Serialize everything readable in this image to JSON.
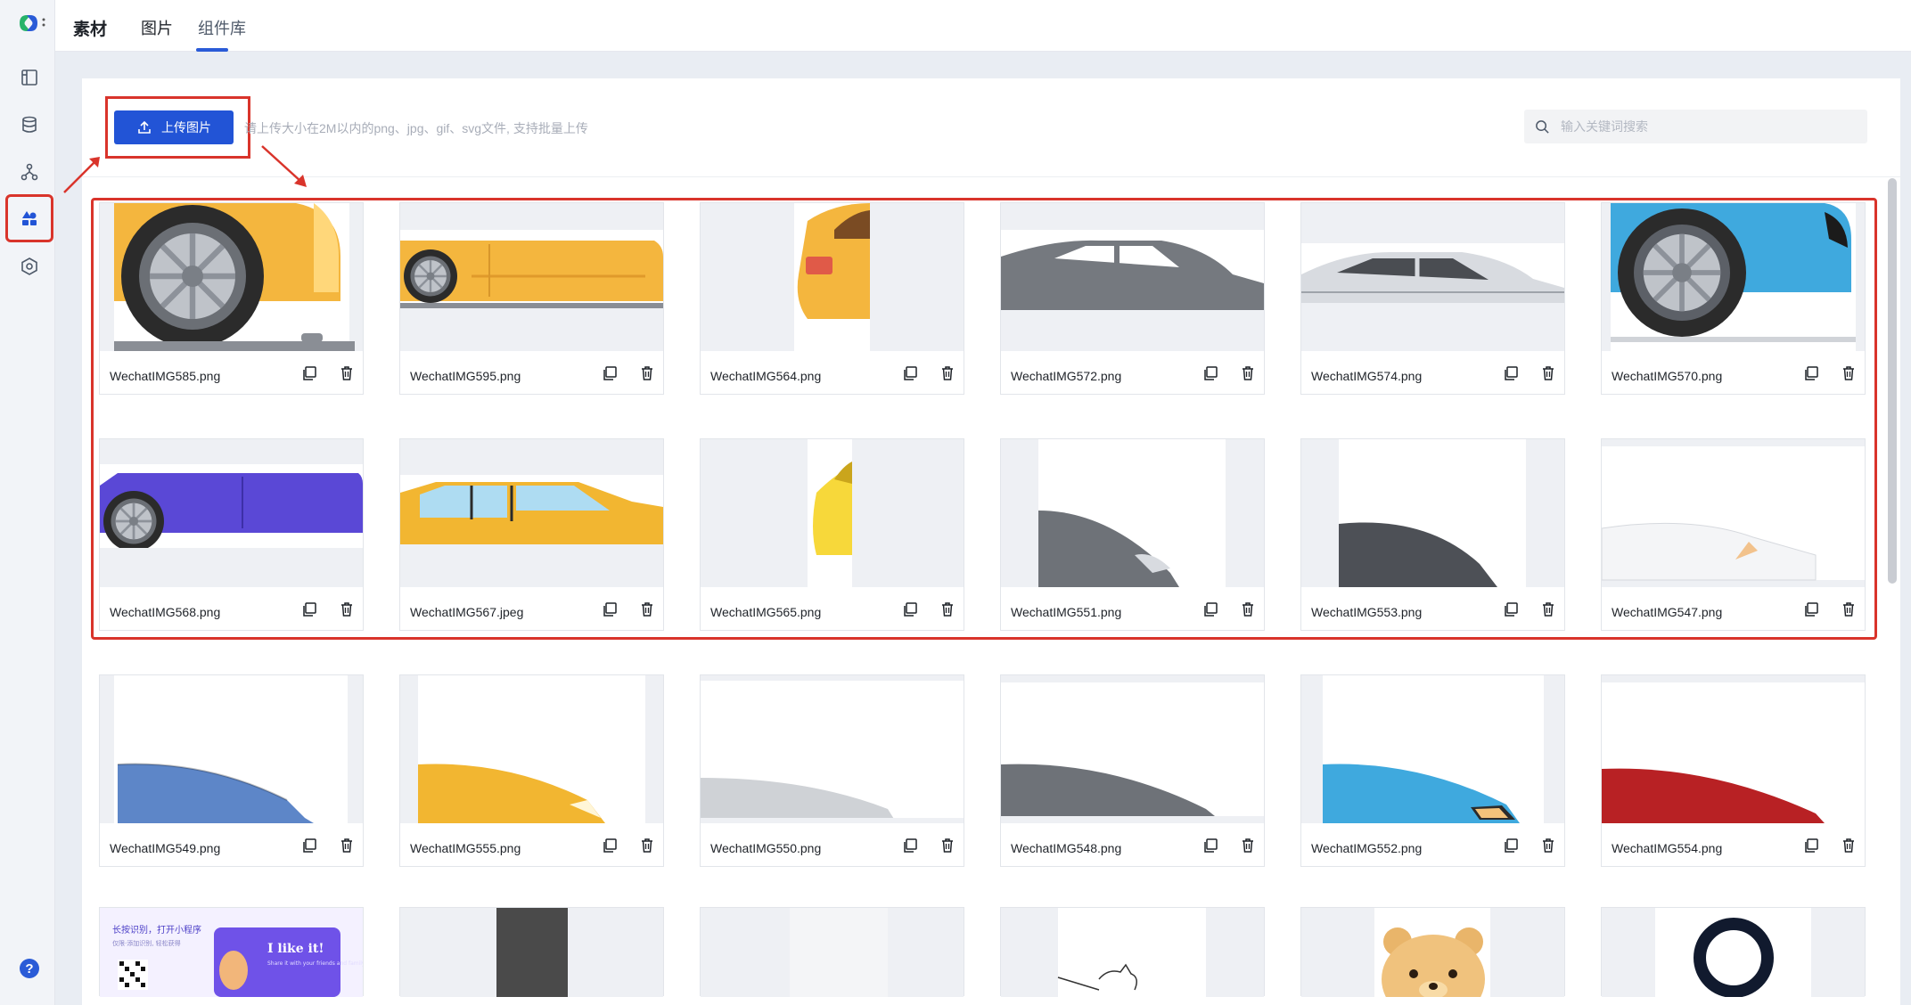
{
  "header": {
    "brand": "素材",
    "tabs": [
      {
        "label": "图片",
        "active": true
      },
      {
        "label": "组件库",
        "active": false
      }
    ]
  },
  "sidebar": {
    "items": [
      {
        "icon": "layout-icon"
      },
      {
        "icon": "database-icon"
      },
      {
        "icon": "flow-icon"
      },
      {
        "icon": "assets-icon",
        "active": true
      },
      {
        "icon": "hexagon-settings-icon"
      }
    ],
    "help_label": "?"
  },
  "toolbar": {
    "upload_label": "上传图片",
    "hint": "请上传大小在2M以内的png、jpg、gif、svg文件, 支持批量上传",
    "search_placeholder": "输入关键词搜索"
  },
  "colors": {
    "accent": "#2254d6",
    "highlight": "#d9342b"
  },
  "images": [
    {
      "name": "WechatIMG585.png",
      "art": "yellow-wheel"
    },
    {
      "name": "WechatIMG595.png",
      "art": "yellow-side"
    },
    {
      "name": "WechatIMG564.png",
      "art": "yellow-rear"
    },
    {
      "name": "WechatIMG572.png",
      "art": "gray-sedan"
    },
    {
      "name": "WechatIMG574.png",
      "art": "silver-sedan"
    },
    {
      "name": "WechatIMG570.png",
      "art": "blue-wheel"
    },
    {
      "name": "WechatIMG568.png",
      "art": "purple-side"
    },
    {
      "name": "WechatIMG567.jpeg",
      "art": "yellow-window"
    },
    {
      "name": "WechatIMG565.png",
      "art": "yellow-sliver"
    },
    {
      "name": "WechatIMG551.png",
      "art": "gray-front"
    },
    {
      "name": "WechatIMG553.png",
      "art": "dark-hood"
    },
    {
      "name": "WechatIMG547.png",
      "art": "white-front"
    },
    {
      "name": "WechatIMG549.png",
      "art": "blue-hood"
    },
    {
      "name": "WechatIMG555.png",
      "art": "yellow-hood"
    },
    {
      "name": "WechatIMG550.png",
      "art": "silver-hood"
    },
    {
      "name": "WechatIMG548.png",
      "art": "gray-hood"
    },
    {
      "name": "WechatIMG552.png",
      "art": "cyan-hood"
    },
    {
      "name": "WechatIMG554.png",
      "art": "red-hood"
    }
  ],
  "bottom_row": [
    {
      "art": "promo",
      "promo_title": "长按识别，打开小程序",
      "promo_sub": "仅限·添加识别, 轻松获得",
      "promo_banner": "I like it!",
      "promo_banner_sub": "Share it with your friends and family"
    },
    {
      "art": "dark-bar"
    },
    {
      "art": "blank"
    },
    {
      "art": "sketch-cat"
    },
    {
      "art": "bear"
    },
    {
      "art": "ring"
    }
  ]
}
